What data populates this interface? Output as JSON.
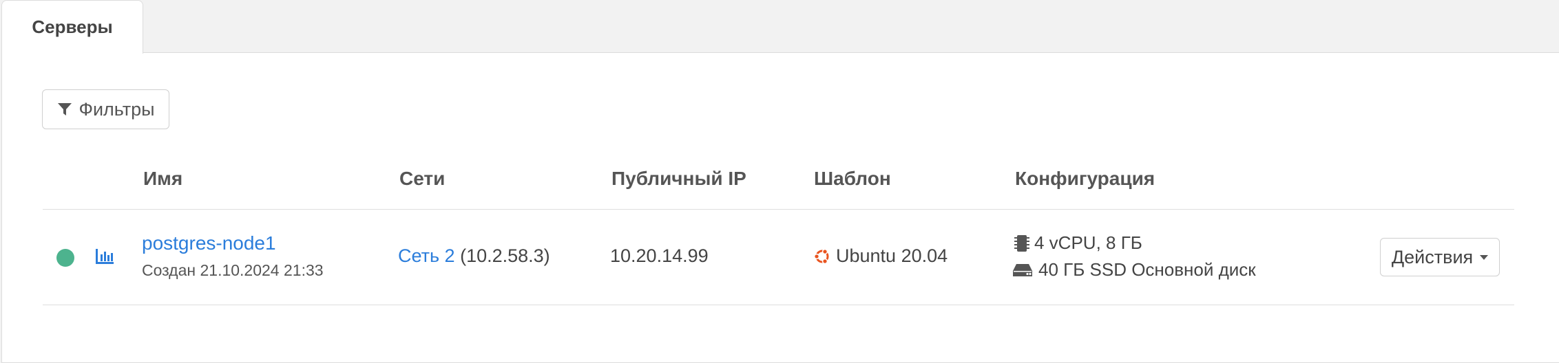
{
  "tabs": [
    {
      "label": "Серверы",
      "active": true
    }
  ],
  "toolbar": {
    "filters_label": "Фильтры",
    "filters_icon": "filter-icon"
  },
  "table": {
    "headers": {
      "name": "Имя",
      "networks": "Сети",
      "public_ip": "Публичный IP",
      "template": "Шаблон",
      "configuration": "Конфигурация"
    },
    "rows": [
      {
        "status": "running",
        "status_color": "#4db38e",
        "stats_icon": "bar-chart-icon",
        "name": "postgres-node1",
        "created": "Создан 21.10.2024 21:33",
        "network_link": "Сеть 2",
        "network_ip": "(10.2.58.3)",
        "public_ip": "10.20.14.99",
        "template_icon": "ubuntu-logo-icon",
        "template": "Ubuntu 20.04",
        "cpu_icon": "cpu-chip-icon",
        "cpu_ram": "4 vCPU, 8 ГБ",
        "disk_icon": "hard-drive-icon",
        "disk": "40 ГБ SSD Основной диск",
        "actions_label": "Действия"
      }
    ]
  },
  "colors": {
    "link": "#2b7ddb",
    "status_running": "#4db38e",
    "ubuntu": "#e95420"
  }
}
